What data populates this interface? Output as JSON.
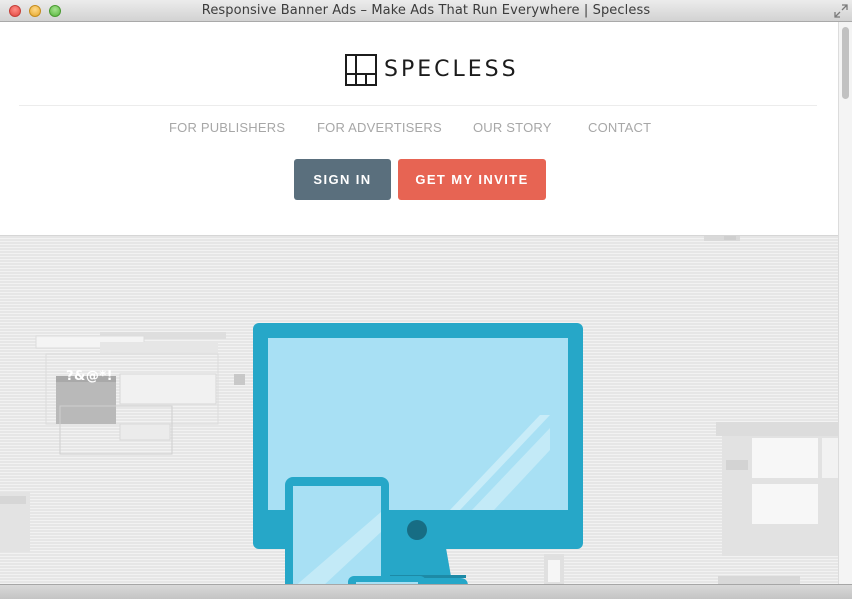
{
  "window": {
    "title": "Responsive Banner Ads – Make Ads That Run Everywhere | Specless"
  },
  "header": {
    "logo_text": "SPECLESS",
    "nav": [
      {
        "label": "FOR PUBLISHERS"
      },
      {
        "label": "FOR ADVERTISERS"
      },
      {
        "label": "OUR STORY"
      },
      {
        "label": "CONTACT"
      }
    ],
    "signin_label": "SIGN IN",
    "invite_label": "GET MY INVITE"
  },
  "hero": {
    "symbols_text": "?&@*!",
    "illustration": "responsive-devices-illustration-icon"
  },
  "colors": {
    "signin_bg": "#5a6f7d",
    "invite_bg": "#e76453",
    "device_frame": "#26a7c8",
    "device_screen": "#a8e0f4",
    "nav_text": "#a7a7a7"
  }
}
